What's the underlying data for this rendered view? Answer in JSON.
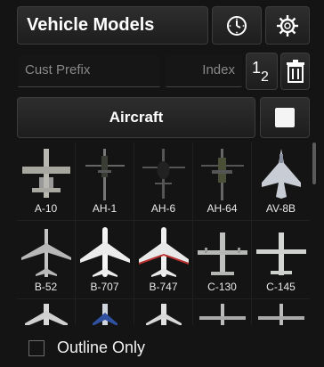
{
  "header": {
    "title": "Vehicle Models",
    "clock_icon": "clock-icon",
    "settings_icon": "gear-icon"
  },
  "filters": {
    "prefix_placeholder": "Cust Prefix",
    "index_placeholder": "Index",
    "subscript_icon": "subscript-icon",
    "delete_icon": "trash-icon"
  },
  "category": {
    "label": "Aircraft",
    "toggle_icon": "square-icon"
  },
  "models": [
    {
      "label": "A-10",
      "icon": "a10-aircraft-icon"
    },
    {
      "label": "AH-1",
      "icon": "ah1-helicopter-icon"
    },
    {
      "label": "AH-6",
      "icon": "ah6-helicopter-icon"
    },
    {
      "label": "AH-64",
      "icon": "ah64-helicopter-icon"
    },
    {
      "label": "AV-8B",
      "icon": "av8b-jet-icon"
    },
    {
      "label": "B-52",
      "icon": "b52-aircraft-icon"
    },
    {
      "label": "B-707",
      "icon": "b707-aircraft-icon"
    },
    {
      "label": "B-747",
      "icon": "b747-aircraft-icon"
    },
    {
      "label": "C-130",
      "icon": "c130-aircraft-icon"
    },
    {
      "label": "C-145",
      "icon": "c145-aircraft-icon"
    },
    {
      "label": "",
      "icon": "aircraft-icon"
    },
    {
      "label": "",
      "icon": "aircraft-icon"
    },
    {
      "label": "",
      "icon": "aircraft-icon"
    },
    {
      "label": "",
      "icon": "aircraft-icon"
    },
    {
      "label": "",
      "icon": "aircraft-icon"
    }
  ],
  "footer": {
    "outline_label": "Outline Only",
    "outline_checked": false
  }
}
